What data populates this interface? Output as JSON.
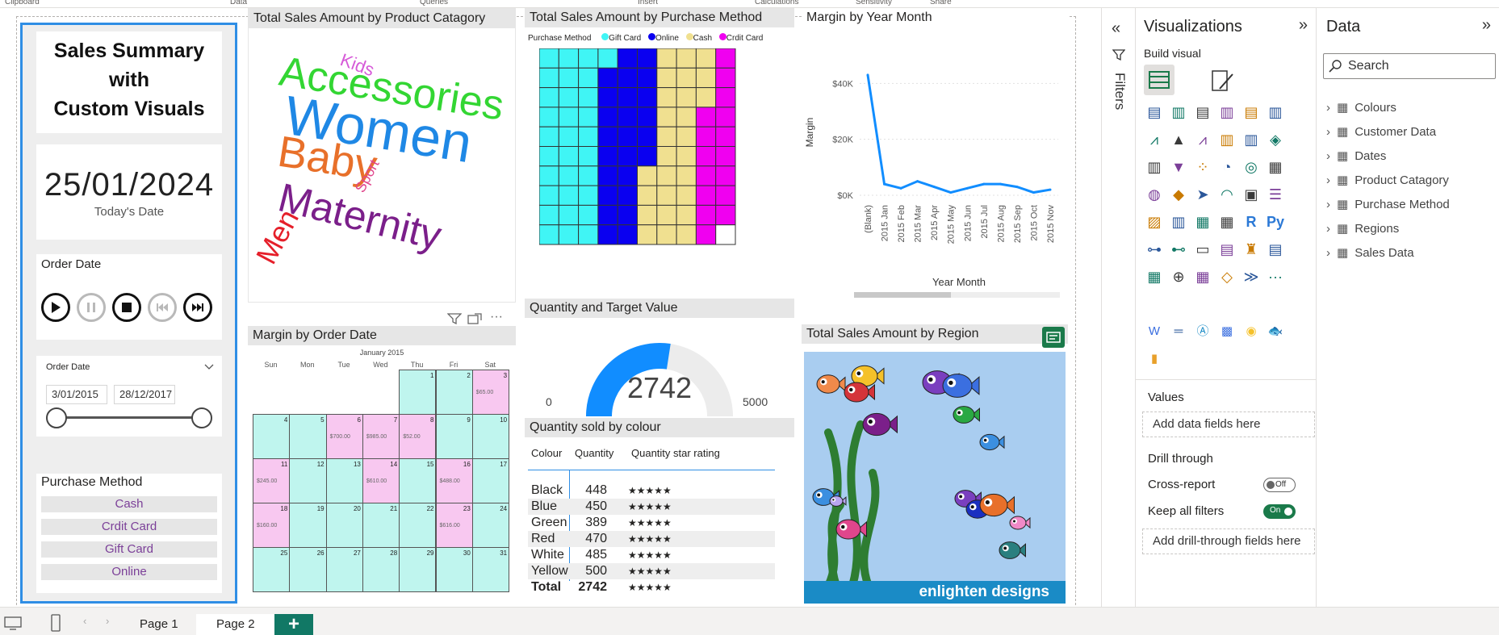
{
  "ribbon": {
    "groups": [
      "Clipboard",
      "Data",
      "Queries",
      "Insert",
      "Calculations",
      "Sensitivity",
      "Share"
    ]
  },
  "summary": {
    "title_line1": "Sales Summary",
    "title_line2": "with",
    "title_line3": "Custom Visuals",
    "date": "25/01/2024",
    "date_caption": "Today's Date"
  },
  "order_date_player": {
    "title": "Order Date"
  },
  "order_date_slicer": {
    "title": "Order Date",
    "start": "3/01/2015",
    "end": "28/12/2017"
  },
  "purchase_slicer": {
    "title": "Purchase Method",
    "items": [
      "Cash",
      "Crdit Card",
      "Gift Card",
      "Online"
    ]
  },
  "wordcloud": {
    "title": "Total Sales Amount by Product Catagory",
    "words": [
      {
        "text": "Kids",
        "color": "#d65ad8"
      },
      {
        "text": "Accessories",
        "color": "#33d633"
      },
      {
        "text": "Women",
        "color": "#1f88e5"
      },
      {
        "text": "Baby",
        "color": "#e8702a"
      },
      {
        "text": "Sport",
        "color": "#e0468c"
      },
      {
        "text": "Maternity",
        "color": "#7b1f8a"
      },
      {
        "text": "Men",
        "color": "#e51f2a"
      }
    ]
  },
  "waffle": {
    "title": "Total Sales Amount by Purchase Method",
    "legend_title": "Purchase Method",
    "legend": [
      {
        "name": "Gift Card",
        "color": "#40f5f5"
      },
      {
        "name": "Online",
        "color": "#0a00f0"
      },
      {
        "name": "Cash",
        "color": "#f0e090"
      },
      {
        "name": "Crdit Card",
        "color": "#f000f0"
      }
    ]
  },
  "margin_line": {
    "title": "Margin by Year Month",
    "ylabel": "Margin",
    "xlabel": "Year Month",
    "yticks": [
      "$40K",
      "$20K",
      "$0K"
    ]
  },
  "calendar": {
    "title": "Margin by Order Date",
    "month": "January 2015",
    "days": [
      "Sun",
      "Mon",
      "Tue",
      "Wed",
      "Thu",
      "Fri",
      "Sat"
    ]
  },
  "gauge": {
    "title": "Quantity and Target Value",
    "value": "2742",
    "min": "0",
    "max": "5000",
    "fraction": 0.5484
  },
  "qtable": {
    "title": "Quantity sold by colour",
    "headers": [
      "Colour",
      "Quantity",
      "Quantity star rating"
    ],
    "rows": [
      {
        "colour": "Black",
        "qty": "448",
        "stars": "★★★★★"
      },
      {
        "colour": "Blue",
        "qty": "450",
        "stars": "★★★★★"
      },
      {
        "colour": "Green",
        "qty": "389",
        "stars": "★★★★★"
      },
      {
        "colour": "Red",
        "qty": "470",
        "stars": "★★★★★"
      },
      {
        "colour": "White",
        "qty": "485",
        "stars": "★★★★★"
      },
      {
        "colour": "Yellow",
        "qty": "500",
        "stars": "★★★★★"
      }
    ],
    "total": {
      "colour": "Total",
      "qty": "2742",
      "stars": "★★★★★"
    }
  },
  "fish": {
    "title": "Total Sales Amount by Region",
    "brand": "enlighten designs"
  },
  "filters": {
    "label": "Filters"
  },
  "visualizations": {
    "title": "Visualizations",
    "build_visual": "Build visual",
    "values_label": "Values",
    "values_placeholder": "Add data fields here",
    "drill_through": "Drill through",
    "cross_report": "Cross-report",
    "cross_report_state": "Off",
    "keep_filters": "Keep all filters",
    "keep_filters_state": "On",
    "drill_placeholder": "Add drill-through fields here"
  },
  "data_pane": {
    "title": "Data",
    "search_placeholder": "Search",
    "tables": [
      "Colours",
      "Customer Data",
      "Dates",
      "Product Catagory",
      "Purchase Method",
      "Regions",
      "Sales Data"
    ]
  },
  "pages": {
    "tabs": [
      "Page 1",
      "Page 2"
    ],
    "add": "+"
  },
  "chart_data": [
    {
      "type": "waffle",
      "title": "Total Sales Amount by Purchase Method",
      "categories": [
        "Gift Card",
        "Online",
        "Cash",
        "Crdit Card"
      ],
      "values": [
        31,
        25,
        27,
        16
      ],
      "colors": [
        "#40f5f5",
        "#0a00f0",
        "#f0e090",
        "#f000f0"
      ]
    },
    {
      "type": "line",
      "title": "Margin by Year Month",
      "x": [
        "(Blank)",
        "2015 Jan",
        "2015 Feb",
        "2015 Mar",
        "2015 Apr",
        "2015 May",
        "2015 Jun",
        "2015 Jul",
        "2015 Aug",
        "2015 Sep",
        "2015 Oct",
        "2015 Nov"
      ],
      "values": [
        43000,
        4000,
        2500,
        5000,
        3000,
        1000,
        2500,
        4000,
        4000,
        3000,
        1000,
        2000
      ],
      "ylim": [
        0,
        45000
      ],
      "xlabel": "Year Month",
      "ylabel": "Margin",
      "color": "#118dff"
    },
    {
      "type": "heatmap",
      "title": "Margin by Order Date",
      "cells": [
        {
          "day": 3,
          "label": "$65.00"
        },
        {
          "day": 6,
          "label": "$700.00"
        },
        {
          "day": 7,
          "label": "$985.00"
        },
        {
          "day": 8,
          "label": "$52.00"
        },
        {
          "day": 11,
          "label": "$245.00"
        },
        {
          "day": 14,
          "label": "$610.00"
        },
        {
          "day": 16,
          "label": "$488.00"
        },
        {
          "day": 18,
          "label": "$160.00"
        },
        {
          "day": 23,
          "label": "$616.00"
        }
      ]
    }
  ]
}
